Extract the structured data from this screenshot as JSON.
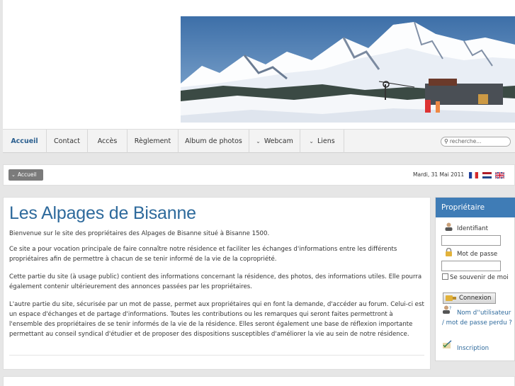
{
  "nav": {
    "items": [
      {
        "label": "Accueil",
        "has_chevron": false
      },
      {
        "label": "Contact",
        "has_chevron": false
      },
      {
        "label": "Accès",
        "has_chevron": false
      },
      {
        "label": "Règlement",
        "has_chevron": false
      },
      {
        "label": "Album de photos",
        "has_chevron": false
      },
      {
        "label": "Webcam",
        "has_chevron": true
      },
      {
        "label": "Liens",
        "has_chevron": true
      }
    ],
    "search_placeholder": "recherche..."
  },
  "breadcrumb": {
    "label": "Accueil",
    "date": "Mardi, 31 Mai 2011",
    "flags": [
      "fr-flag-icon",
      "nl-flag-icon",
      "uk-flag-icon"
    ]
  },
  "main": {
    "title": "Les Alpages de Bisanne",
    "paragraphs": [
      "Bienvenue sur le site des propriétaires des Alpages de Bisanne situé à Bisanne 1500.",
      "Ce site a pour vocation principale de faire connaître notre résidence et faciliter les échanges d'informations entre les différents propriétaires afin de permettre à chacun de se tenir informé de la vie de la copropriété.",
      "Cette partie du site (à usage public) contient des informations concernant la résidence, des photos, des informations utiles. Elle pourra également contenir ultérieurement des annonces passées par les propriétaires.",
      "L'autre partie du site, sécurisée par un mot de passe, permet aux propriétaires qui en font la demande, d'accéder au forum. Celui-ci est un espace d'échanges et de partage d'informations. Toutes les contributions ou les remarques qui seront faites permettront à l'ensemble des propriétaires de se tenir informés de la vie de la résidence. Elles seront également une base de réflexion importante permettant au conseil syndical d'étudier et de proposer des dispositions susceptibles d'améliorer la vie au sein de notre résidence."
    ]
  },
  "sidebar": {
    "title": "Propriétaire",
    "username_label": "Identifiant",
    "password_label": "Mot de passe",
    "remember_label": "Se souvenir de moi",
    "login_button": "Connexion",
    "forgot_link": "Nom d''utilisateur / mot de passe perdu ?",
    "register_link": "Inscription"
  },
  "colors": {
    "accent": "#2e6a9c",
    "sidebar_header": "#3f7cb6",
    "page_bg": "#e6e6e6"
  }
}
